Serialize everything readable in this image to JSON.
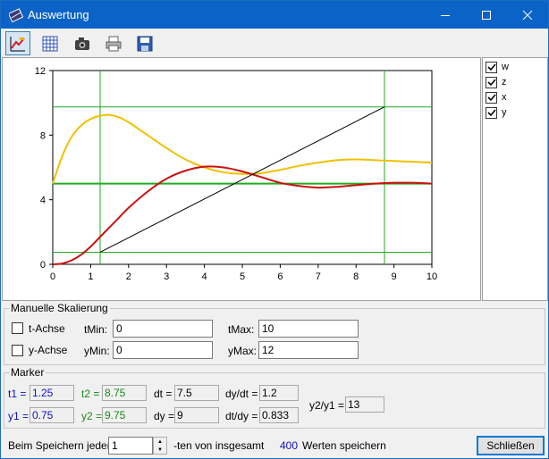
{
  "window": {
    "title": "Auswertung"
  },
  "toolbar": {
    "buttons": [
      {
        "icon": "edit-chart-icon",
        "pressed": true
      },
      {
        "icon": "grid-icon",
        "pressed": false
      },
      {
        "icon": "camera-icon",
        "pressed": false
      },
      {
        "icon": "printer-icon",
        "pressed": false
      },
      {
        "icon": "save-icon",
        "pressed": false
      }
    ]
  },
  "legend": [
    {
      "label": "w",
      "checked": true
    },
    {
      "label": "z",
      "checked": true
    },
    {
      "label": "x",
      "checked": true
    },
    {
      "label": "y",
      "checked": true
    }
  ],
  "chart_data": {
    "type": "line",
    "xlim": [
      0,
      10
    ],
    "ylim": [
      0,
      12
    ],
    "x_ticks": [
      "0",
      "1",
      "2",
      "3",
      "4",
      "5",
      "6",
      "7",
      "8",
      "9",
      "10"
    ],
    "y_ticks": [
      "0",
      "4",
      "8",
      "12"
    ],
    "series": [
      {
        "name": "w",
        "color": "#22aa22",
        "x": [
          0,
          10
        ],
        "y": [
          5,
          5
        ]
      },
      {
        "name": "z",
        "color": "#f0c000",
        "x": [
          0,
          0.25,
          0.5,
          0.75,
          1.0,
          1.25,
          1.5,
          1.75,
          2.0,
          2.5,
          3.0,
          3.5,
          4.0,
          4.5,
          5.0,
          5.5,
          6.0,
          6.5,
          7.0,
          7.5,
          8.0,
          8.5,
          9.0,
          9.5,
          10.0
        ],
        "y": [
          5.0,
          6.7,
          7.9,
          8.6,
          9.0,
          9.2,
          9.25,
          9.1,
          8.8,
          8.0,
          7.2,
          6.5,
          6.0,
          5.7,
          5.6,
          5.65,
          5.85,
          6.1,
          6.3,
          6.45,
          6.5,
          6.45,
          6.4,
          6.35,
          6.3
        ]
      },
      {
        "name": "x",
        "color": "#cc1010",
        "x": [
          0,
          0.25,
          0.5,
          0.75,
          1.0,
          1.25,
          1.5,
          1.75,
          2.0,
          2.5,
          3.0,
          3.5,
          4.0,
          4.5,
          5.0,
          5.5,
          6.0,
          6.5,
          7.0,
          7.5,
          8.0,
          8.5,
          9.0,
          9.5,
          10.0
        ],
        "y": [
          0,
          0.05,
          0.25,
          0.6,
          1.1,
          1.7,
          2.3,
          2.9,
          3.5,
          4.5,
          5.3,
          5.8,
          6.05,
          6.0,
          5.75,
          5.4,
          5.05,
          4.85,
          4.75,
          4.8,
          4.9,
          5.0,
          5.05,
          5.05,
          5.0
        ]
      },
      {
        "name": "y",
        "color": "#000000",
        "x": [
          1.25,
          8.75
        ],
        "y": [
          0.75,
          9.75
        ]
      }
    ],
    "markers": {
      "t1": 1.25,
      "t2": 8.75,
      "y1": 0.75,
      "y2": 9.75,
      "color": "#22aa22"
    }
  },
  "scaling": {
    "title": "Manuelle Skalierung",
    "t_axis_label": "t-Achse",
    "y_axis_label": "y-Achse",
    "tmin_label": "tMin:",
    "tmin_value": "0",
    "tmax_label": "tMax:",
    "tmax_value": "10",
    "ymin_label": "yMin:",
    "ymin_value": "0",
    "ymax_label": "yMax:",
    "ymax_value": "12"
  },
  "marker_panel": {
    "title": "Marker",
    "t1_label": "t1 =",
    "t1": "1.25",
    "t2_label": "t2 =",
    "t2": "8.75",
    "dt_label": "dt =",
    "dt": "7.5",
    "dydt_label": "dy/dt =",
    "dydt": "1.2",
    "y1_label": "y1 =",
    "y1": "0.75",
    "y2_label": "y2 =",
    "y2": "9.75",
    "dy_label": "dy =",
    "dy": "9",
    "dtdy_label": "dt/dy =",
    "dtdy": "0.833",
    "ratio_label": "y2/y1 =",
    "ratio": "13"
  },
  "footer": {
    "save_every_label": "Beim Speichern jeden",
    "spinner_value": "1",
    "of_total_label": "-ten von insgesamt",
    "total": "400",
    "values_save_label": "Werten speichern",
    "close_button": "Schließen"
  }
}
